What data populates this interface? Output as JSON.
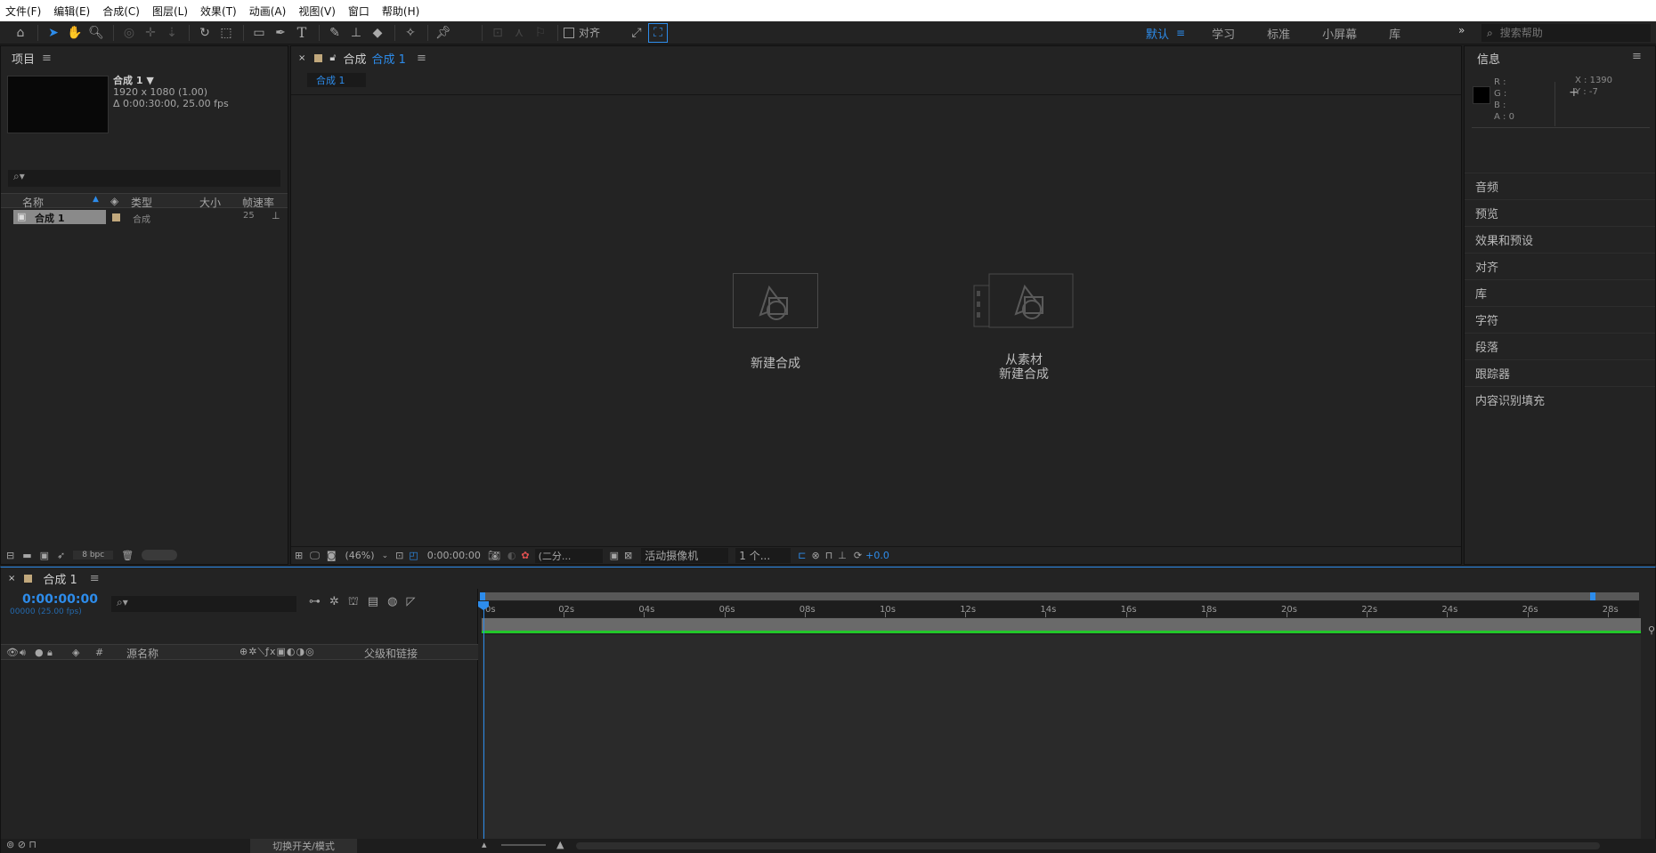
{
  "menu": [
    "文件(F)",
    "编辑(E)",
    "合成(C)",
    "图层(L)",
    "效果(T)",
    "动画(A)",
    "视图(V)",
    "窗口",
    "帮助(H)"
  ],
  "toolbar": {
    "align_label": "对齐",
    "workspaces": [
      "默认",
      "学习",
      "标准",
      "小屏幕",
      "库"
    ],
    "search_placeholder": "搜索帮助"
  },
  "project": {
    "title": "项目",
    "comp_name": "合成 1",
    "comp_res": "1920 x 1080 (1.00)",
    "comp_duration": "Δ 0:00:30:00, 25.00 fps",
    "headers": [
      "名称",
      "类型",
      "大小",
      "帧速率"
    ],
    "row": {
      "name": "合成 1",
      "type": "合成",
      "fps": "25"
    },
    "bpc": "8 bpc"
  },
  "comp": {
    "tab_prefix": "合成",
    "tab_name": "合成 1",
    "sub_tab": "合成 1",
    "new_comp": "新建合成",
    "from_footage_line1": "从素材",
    "from_footage_line2": "新建合成",
    "zoom": "(46%)",
    "timecode": "0:00:00:00",
    "resolution": "(二分...",
    "camera": "活动摄像机",
    "views": "1 个...",
    "exposure": "+0.0"
  },
  "info": {
    "title": "信息",
    "r": "R :",
    "g": "G :",
    "b": "B :",
    "a": "A : 0",
    "x": "X : 1390",
    "y": "Y : -7"
  },
  "right_panels": [
    "音频",
    "预览",
    "效果和预设",
    "对齐",
    "库",
    "字符",
    "段落",
    "跟踪器",
    "内容识别填充"
  ],
  "timeline": {
    "tab": "合成 1",
    "timecode": "0:00:00:00",
    "frames": "00000 (25.00 fps)",
    "cols": {
      "hash": "#",
      "source": "源名称",
      "parent": "父级和链接"
    },
    "ruler": [
      "0s",
      "02s",
      "04s",
      "06s",
      "08s",
      "10s",
      "12s",
      "14s",
      "16s",
      "18s",
      "20s",
      "22s",
      "24s",
      "26s",
      "28s"
    ],
    "footer": "切换开关/模式"
  },
  "colors": {
    "accent": "#2d8ceb",
    "panel": "#232323",
    "bg": "#1d1d1d",
    "green": "#22c72a"
  }
}
